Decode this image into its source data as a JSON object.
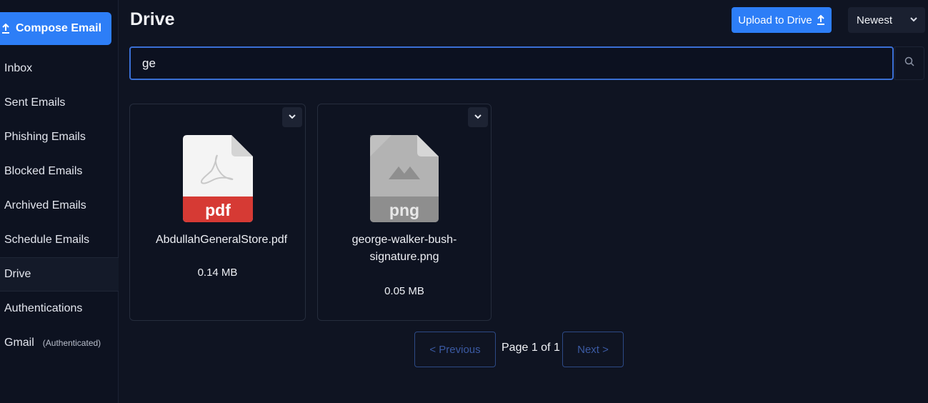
{
  "sidebar": {
    "compose_label": "Compose Email",
    "items": [
      {
        "label": "Inbox"
      },
      {
        "label": "Sent Emails"
      },
      {
        "label": "Phishing Emails"
      },
      {
        "label": "Blocked Emails"
      },
      {
        "label": "Archived Emails"
      },
      {
        "label": "Schedule Emails"
      },
      {
        "label": "Drive"
      },
      {
        "label": "Authentications"
      },
      {
        "label": "Gmail",
        "badge": "(Authenticated)"
      }
    ]
  },
  "header": {
    "title": "Drive",
    "upload_label": "Upload to Drive",
    "sort_value": "Newest"
  },
  "search": {
    "value": "ge"
  },
  "files": [
    {
      "name": "AbdullahGeneralStore.pdf",
      "size": "0.14 MB",
      "type_label": "pdf",
      "icon": "pdf-file-icon"
    },
    {
      "name": "george-walker-bush-signature.png",
      "size": "0.05 MB",
      "type_label": "png",
      "icon": "image-file-icon"
    }
  ],
  "pagination": {
    "prev_label": "< Previous",
    "page_text": "Page 1 of 1",
    "next_label": "Next >"
  },
  "colors": {
    "accent": "#2d7ef7",
    "background": "#0f1422",
    "pdf_red": "#d63a34",
    "png_gray": "#9a9a9a"
  }
}
